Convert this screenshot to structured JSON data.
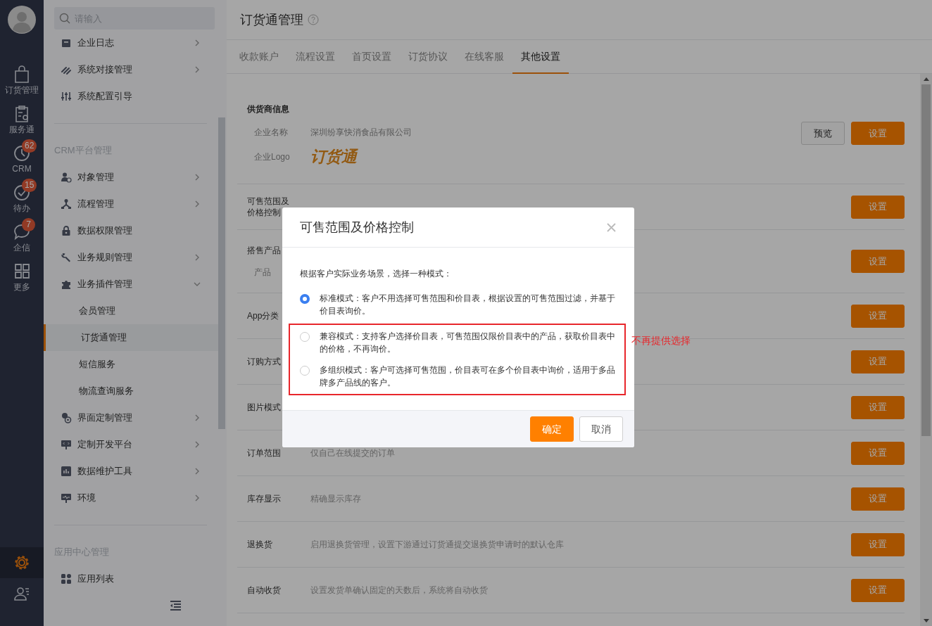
{
  "rail": {
    "items": [
      {
        "label": "订货管理"
      },
      {
        "label": "服务通"
      },
      {
        "label": "CRM",
        "badge": "62"
      },
      {
        "label": "待办",
        "badge": "15"
      },
      {
        "label": "企信",
        "badge": "7"
      },
      {
        "label": "更多"
      }
    ],
    "bottom": [
      {
        "selected": true
      },
      {
        "selected": false
      }
    ]
  },
  "sidebar": {
    "search": {
      "placeholder": "请输入"
    },
    "groups": [
      {
        "items": [
          {
            "label": "企业日志",
            "kind": "expandable",
            "expanded": false
          },
          {
            "label": "系统对接管理",
            "kind": "expandable",
            "expanded": false
          },
          {
            "label": "系统配置引导",
            "kind": "plain"
          }
        ]
      },
      {
        "title": "CRM平台管理",
        "items": [
          {
            "label": "对象管理",
            "kind": "expandable",
            "expanded": false
          },
          {
            "label": "流程管理",
            "kind": "expandable",
            "expanded": false
          },
          {
            "label": "数据权限管理",
            "kind": "plain"
          },
          {
            "label": "业务规则管理",
            "kind": "expandable",
            "expanded": false
          },
          {
            "label": "业务插件管理",
            "kind": "expandable",
            "expanded": true,
            "children": [
              {
                "label": "会员管理",
                "selected": false
              },
              {
                "label": "订货通管理",
                "selected": true
              },
              {
                "label": "短信服务",
                "selected": false
              },
              {
                "label": "物流查询服务",
                "selected": false
              }
            ]
          },
          {
            "label": "界面定制管理",
            "kind": "expandable",
            "expanded": false
          },
          {
            "label": "定制开发平台",
            "kind": "expandable",
            "expanded": false
          },
          {
            "label": "数据维护工具",
            "kind": "expandable",
            "expanded": false
          },
          {
            "label": "环境",
            "kind": "expandable",
            "expanded": false
          }
        ]
      },
      {
        "title": "应用中心管理",
        "items": [
          {
            "label": "应用列表",
            "kind": "plain"
          }
        ]
      }
    ]
  },
  "main": {
    "title": "订货通管理",
    "tabs": [
      {
        "label": "收款账户",
        "selected": false
      },
      {
        "label": "流程设置",
        "selected": false
      },
      {
        "label": "首页设置",
        "selected": false
      },
      {
        "label": "订货协议",
        "selected": false
      },
      {
        "label": "在线客服",
        "selected": false
      },
      {
        "label": "其他设置",
        "selected": true
      }
    ],
    "sections": [
      {
        "kind": "supplier",
        "title": "供货商信息",
        "fields": [
          {
            "label": "企业名称",
            "value": "深圳纷享快消食品有限公司"
          },
          {
            "label": "企业Logo",
            "logo": "订货通"
          }
        ],
        "buttons": [
          {
            "kind": "secondary",
            "label": "预览"
          },
          {
            "kind": "primary",
            "label": "设置"
          }
        ]
      },
      {
        "kind": "setting",
        "label": "可售范围及价格控制",
        "button": "设置"
      },
      {
        "kind": "setting",
        "label": "搭售产品",
        "sub": "产品",
        "button": "设置"
      },
      {
        "kind": "setting",
        "label": "App分类",
        "button": "设置"
      },
      {
        "kind": "setting",
        "label": "订购方式",
        "button": "设置"
      },
      {
        "kind": "setting",
        "label": "图片模式",
        "button": "设置"
      },
      {
        "kind": "setting",
        "label": "订单范围",
        "value": "仅自己在线提交的订单",
        "button": "设置"
      },
      {
        "kind": "setting",
        "label": "库存显示",
        "value": "精确显示库存",
        "button": "设置"
      },
      {
        "kind": "setting",
        "label": "退换货",
        "value": "启用退换货管理，设置下游通过订货通提交退换货申请时的默认仓库",
        "button": "设置"
      },
      {
        "kind": "setting",
        "label": "自动收货",
        "value": "设置发货单确认固定的天数后，系统将自动收货",
        "button": "设置"
      }
    ]
  },
  "modal": {
    "title": "可售范围及价格控制",
    "prompt": "根据客户实际业务场景，选择一种模式：",
    "options": [
      {
        "label": "标准模式：客户不用选择可售范围和价目表，根据设置的可售范围过滤，并基于价目表询价。",
        "selected": true,
        "annotated": false
      },
      {
        "label": "兼容模式：支持客户选择价目表，可售范围仅限价目表中的产品，获取价目表中的价格，不再询价。",
        "selected": false,
        "annotated": true
      },
      {
        "label": "多组织模式：客户可选择可售范围，价目表可在多个价目表中询价，适用于多品牌多产品线的客户。",
        "selected": false,
        "annotated": true
      }
    ],
    "annotation": "不再提供选择",
    "buttons": [
      {
        "kind": "primary",
        "label": "确定"
      },
      {
        "kind": "secondary",
        "label": "取消"
      }
    ]
  }
}
